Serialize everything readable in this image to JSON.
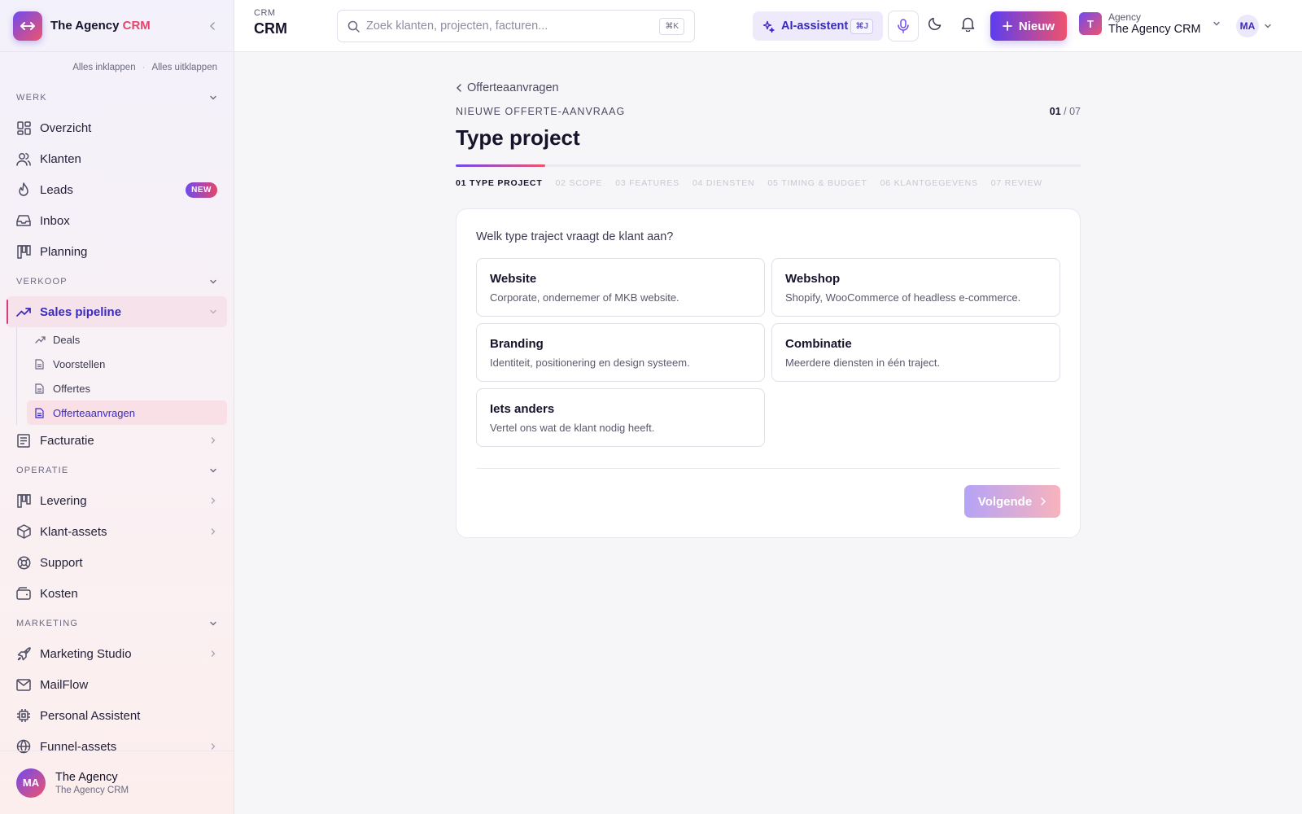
{
  "sidebar": {
    "brand": {
      "name": "The Agency",
      "accent": "CRM"
    },
    "actions": {
      "collapse_all": "Alles inklappen",
      "expand_all": "Alles uitklappen",
      "separator": "·"
    },
    "sections": {
      "werk": "WERK",
      "verkoop": "VERKOOP",
      "operatie": "OPERATIE",
      "marketing": "MARKETING"
    },
    "items": {
      "overzicht": "Overzicht",
      "klanten": "Klanten",
      "leads": "Leads",
      "leads_badge": "NEW",
      "inbox": "Inbox",
      "planning": "Planning",
      "sales_pipeline": "Sales pipeline",
      "deals": "Deals",
      "voorstellen": "Voorstellen",
      "offertes": "Offertes",
      "offerteaanvragen": "Offerteaanvragen",
      "facturatie": "Facturatie",
      "levering": "Levering",
      "klant_assets": "Klant-assets",
      "support": "Support",
      "kosten": "Kosten",
      "marketing_studio": "Marketing Studio",
      "mailflow": "MailFlow",
      "personal_assistent": "Personal Assistent",
      "funnel_assets": "Funnel-assets"
    },
    "footer": {
      "initials": "MA",
      "name": "The Agency",
      "sub": "The Agency CRM"
    }
  },
  "topbar": {
    "crumb_small": "CRM",
    "crumb_big": "CRM",
    "search_placeholder": "Zoek klanten, projecten, facturen...",
    "search_kbd": "⌘K",
    "ai_label": "AI-assistent",
    "ai_kbd": "⌘J",
    "new_label": "Nieuw",
    "org_small": "Agency",
    "org_big": "The Agency CRM",
    "org_initial": "T",
    "user_initials": "MA"
  },
  "main": {
    "back_label": "Offerteaanvragen",
    "eyebrow": "NIEUWE OFFERTE-AANVRAAG",
    "step_current": "01",
    "step_total": " / 07",
    "title": "Type project",
    "progress_fraction": 0.143,
    "steps": [
      "01 TYPE PROJECT",
      "02 SCOPE",
      "03 FEATURES",
      "04 DIENSTEN",
      "05 TIMING & BUDGET",
      "06 KLANTGEGEVENS",
      "07 REVIEW"
    ],
    "question": "Welk type traject vraagt de klant aan?",
    "options": [
      {
        "title": "Website",
        "desc": "Corporate, ondernemer of MKB website."
      },
      {
        "title": "Webshop",
        "desc": "Shopify, WooCommerce of headless e-commerce."
      },
      {
        "title": "Branding",
        "desc": "Identiteit, positionering en design systeem."
      },
      {
        "title": "Combinatie",
        "desc": "Meerdere diensten in één traject."
      },
      {
        "title": "Iets anders",
        "desc": "Vertel ons wat de klant nodig heeft."
      }
    ],
    "next_label": "Volgende"
  },
  "colors": {
    "accent": "#6f4bef",
    "brand_pink": "#f0526c",
    "active_text": "#3a2bbf"
  }
}
